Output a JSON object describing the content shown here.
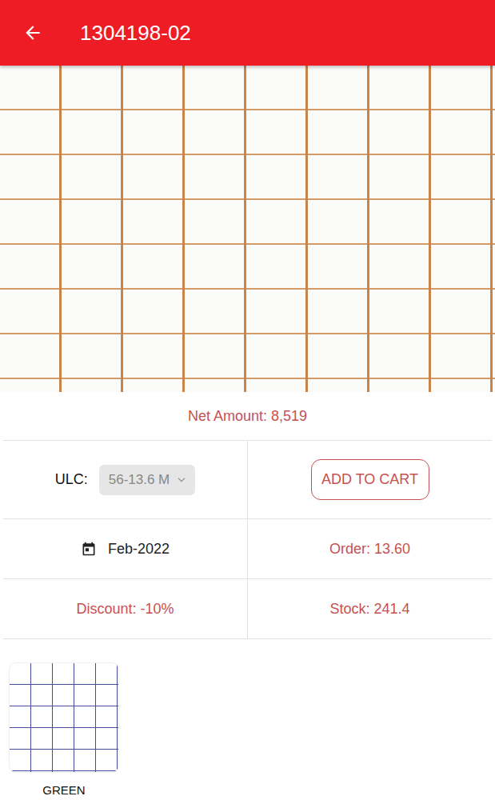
{
  "header": {
    "title": "1304198-02"
  },
  "net_amount": "Net Amount: 8,519",
  "ulc": {
    "label": "ULC:",
    "value": "56-13.6 M",
    "disabled": true
  },
  "add_to_cart": "ADD TO CART",
  "date": "Feb-2022",
  "order": "Order: 13.60",
  "discount": "Discount: -10%",
  "stock": "Stock: 241.4",
  "variants": [
    {
      "label": "GREEN",
      "selected": false
    }
  ]
}
